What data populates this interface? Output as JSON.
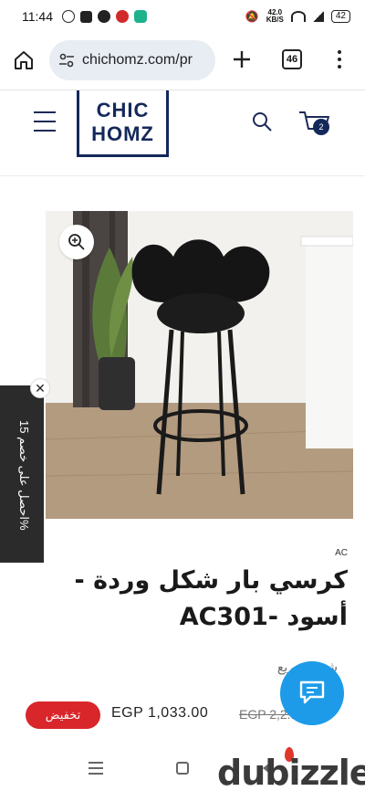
{
  "status_bar": {
    "time": "11:44",
    "net_speed_value": "42.0",
    "net_speed_unit": "KB/S",
    "battery": "42"
  },
  "browser": {
    "url": "chichomz.com/pr",
    "tab_count": "46"
  },
  "header": {
    "logo_line1": "CHIC",
    "logo_line2": "HOMZ",
    "cart_count": "2"
  },
  "promo": {
    "text": "احصل على خصم 15%",
    "close_label": "✕"
  },
  "product": {
    "brand": "AC",
    "title_line1": "كرسي بار شكل وردة -",
    "title_line2": "أسود -AC301",
    "shipping": "شحن سريع",
    "sale_label": "تخفيض",
    "price_new": "EGP 1,033.00",
    "price_old": "EGP 2,2..."
  },
  "watermark": "dubizzle",
  "colors": {
    "brand_navy": "#14285a",
    "sale_red": "#d8262a",
    "chat_blue": "#1d9be8"
  },
  "icons": [
    "home-icon",
    "tune-icon",
    "plus-icon",
    "tabs-icon",
    "more-icon",
    "menu-icon",
    "search-icon",
    "cart-icon",
    "zoom-icon",
    "close-icon",
    "chat-icon"
  ]
}
